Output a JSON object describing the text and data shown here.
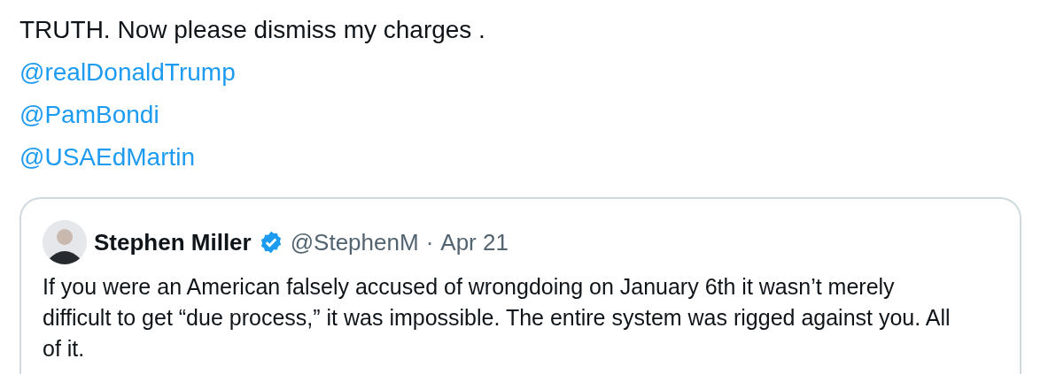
{
  "post": {
    "text": "TRUTH. Now please dismiss my charges .",
    "mentions": [
      "@realDonaldTrump",
      "@PamBondi",
      "@USAEdMartin"
    ]
  },
  "quoted_post": {
    "author": "Stephen Miller",
    "verified": true,
    "handle": "@StephenM",
    "separator": "·",
    "date": "Apr 21",
    "text": "If you were an American falsely accused of wrongdoing on January 6th it wasn’t merely difficult to get “due process,” it was impossible. The entire system was rigged against you. All of it."
  }
}
